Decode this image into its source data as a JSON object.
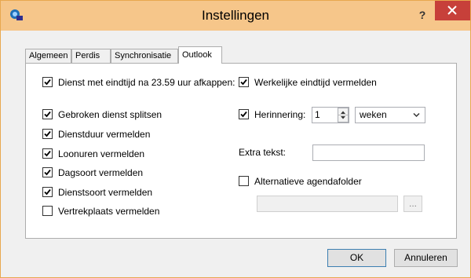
{
  "window": {
    "title": "Instellingen",
    "help_label": "?",
    "colors": {
      "titlebar": "#f6c68a",
      "close": "#c7403a"
    }
  },
  "tabs": [
    {
      "label": "Algemeen",
      "active": false
    },
    {
      "label": "Perdis",
      "active": false
    },
    {
      "label": "Synchronisatie",
      "active": false
    },
    {
      "label": "Outlook",
      "active": true
    }
  ],
  "left_options": [
    {
      "label": "Dienst met eindtijd na 23.59 uur afkappen:",
      "checked": true
    },
    {
      "label": "Gebroken dienst splitsen",
      "checked": true
    },
    {
      "label": "Dienstduur vermelden",
      "checked": true
    },
    {
      "label": "Loonuren vermelden",
      "checked": true
    },
    {
      "label": "Dagsoort vermelden",
      "checked": true
    },
    {
      "label": "Dienstsoort vermelden",
      "checked": true
    },
    {
      "label": "Vertrekplaats vermelden",
      "checked": false
    }
  ],
  "right": {
    "actual_end": {
      "label": "Werkelijke eindtijd vermelden",
      "checked": true
    },
    "reminder": {
      "label": "Herinnering:",
      "checked": true,
      "value": "1",
      "unit": "weken"
    },
    "extra_text": {
      "label": "Extra tekst:",
      "value": ""
    },
    "alt_folder": {
      "label": "Alternatieve agendafolder",
      "checked": false,
      "value": "",
      "browse_label": "..."
    }
  },
  "buttons": {
    "ok": "OK",
    "cancel": "Annuleren"
  }
}
